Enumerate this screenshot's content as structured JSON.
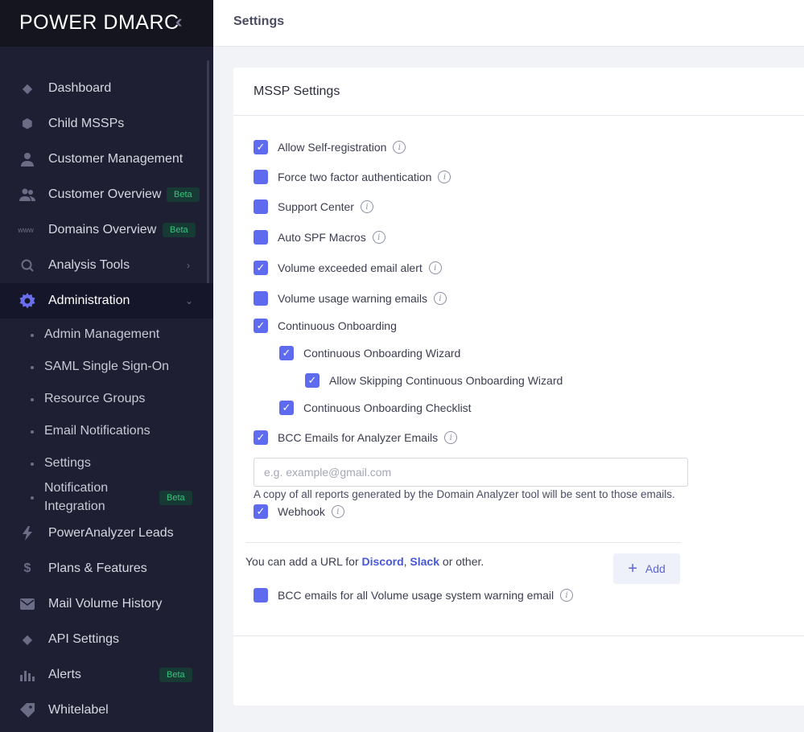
{
  "app": {
    "logo": "POWER DMARC"
  },
  "sidebar": {
    "items": [
      {
        "label": "Dashboard",
        "icon": "diamond-icon"
      },
      {
        "label": "Child MSSPs",
        "icon": "hexagon-icon"
      },
      {
        "label": "Customer Management",
        "icon": "user-icon"
      },
      {
        "label": "Customer Overview",
        "icon": "users-icon",
        "badge": "Beta"
      },
      {
        "label": "Domains Overview",
        "icon": "www-icon",
        "badge": "Beta"
      },
      {
        "label": "Analysis Tools",
        "icon": "search-icon"
      },
      {
        "label": "Administration",
        "icon": "gear-icon"
      },
      {
        "label": "PowerAnalyzer Leads",
        "icon": "bolt-icon"
      },
      {
        "label": "Plans & Features",
        "icon": "dollar-icon"
      },
      {
        "label": "Mail Volume History",
        "icon": "envelope-icon"
      },
      {
        "label": "API Settings",
        "icon": "diamond-icon"
      },
      {
        "label": "Alerts",
        "icon": "bar-chart-icon",
        "badge": "Beta"
      },
      {
        "label": "Whitelabel",
        "icon": "tag-icon"
      }
    ],
    "admin_sub": [
      {
        "label": "Admin Management"
      },
      {
        "label": "SAML Single Sign-On"
      },
      {
        "label": "Resource Groups"
      },
      {
        "label": "Email Notifications"
      },
      {
        "label": "Settings"
      },
      {
        "label": "Notification Integration",
        "line1": "Notification",
        "line2": "Integration",
        "badge": "Beta"
      }
    ]
  },
  "header": {
    "title": "Settings"
  },
  "card": {
    "title": "MSSP Settings",
    "options": [
      {
        "label": "Allow Self-registration",
        "checked": true,
        "info": true
      },
      {
        "label": "Force two factor authentication",
        "checked": false,
        "info": true
      },
      {
        "label": "Support Center",
        "checked": false,
        "info": true
      },
      {
        "label": "Auto SPF Macros",
        "checked": false,
        "info": true
      },
      {
        "label": "Volume exceeded email alert",
        "checked": true,
        "info": true
      },
      {
        "label": "Volume usage warning emails",
        "checked": false,
        "info": true
      },
      {
        "label": "Continuous Onboarding",
        "checked": true,
        "info": false
      },
      {
        "label": "Continuous Onboarding Wizard",
        "checked": true,
        "info": false
      },
      {
        "label": "Allow Skipping Continuous Onboarding Wizard",
        "checked": true,
        "info": false
      },
      {
        "label": "Continuous Onboarding Checklist",
        "checked": true,
        "info": false
      },
      {
        "label": "BCC Emails for Analyzer Emails",
        "checked": true,
        "info": true
      },
      {
        "label": "Webhook",
        "checked": true,
        "info": true
      },
      {
        "label": "BCC emails for all Volume usage system warning email",
        "checked": false,
        "info": true
      }
    ],
    "email_placeholder": "e.g. example@gmail.com",
    "email_helper": "A copy of all reports generated by the Domain Analyzer tool will be sent to those emails.",
    "webhook_text_prefix": "You can add a URL for ",
    "webhook_link1": "Discord",
    "webhook_sep": ", ",
    "webhook_link2": "Slack",
    "webhook_text_suffix": " or other.",
    "add_label": "Add"
  },
  "colors": {
    "accent": "#5f6bee",
    "sidebar_bg": "#1f1f33",
    "beta_green": "#37c47c"
  }
}
